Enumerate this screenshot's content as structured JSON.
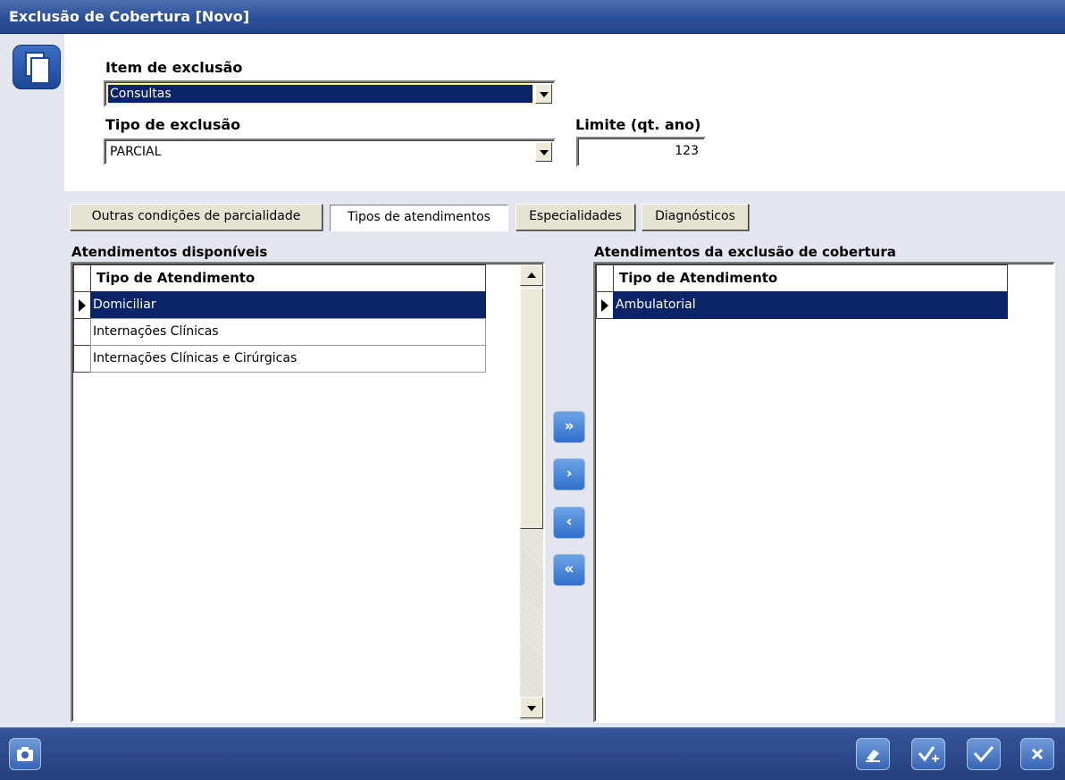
{
  "window": {
    "title": "Exclusão de Cobertura [Novo]"
  },
  "form": {
    "item_label": "Item de exclusão",
    "item_value": "Consultas",
    "tipo_label": "Tipo de exclusão",
    "tipo_value": "PARCIAL",
    "limite_label": "Limite (qt. ano)",
    "limite_value": "123"
  },
  "tabs": [
    {
      "label": "Outras condições de parcialidade"
    },
    {
      "label": "Tipos de atendimentos",
      "active": true
    },
    {
      "label": "Especialidades"
    },
    {
      "label": "Diagnósticos"
    }
  ],
  "available": {
    "title": "Atendimentos disponíveis",
    "column": "Tipo de Atendimento",
    "rows": [
      "Domiciliar",
      "Internações Clínicas",
      "Internações Clínicas e Cirúrgicas"
    ]
  },
  "selected": {
    "title": "Atendimentos da exclusão de cobertura",
    "column": "Tipo de Atendimento",
    "rows": [
      "Ambulatorial"
    ]
  },
  "move_buttons": {
    "add_all": "»",
    "add_one": "›",
    "remove_one": "‹",
    "remove_all": "«"
  },
  "icons": {
    "document": "documents-icon",
    "camera": "camera-icon",
    "eraser": "eraser-icon",
    "confirm_new": "check-plus-icon",
    "confirm": "check-icon",
    "close": "close-icon"
  },
  "colors": {
    "titlebar": "#2b4f97",
    "selection": "#0a246a",
    "panel": "#e3e6ef",
    "buttons": "#3865b5"
  }
}
